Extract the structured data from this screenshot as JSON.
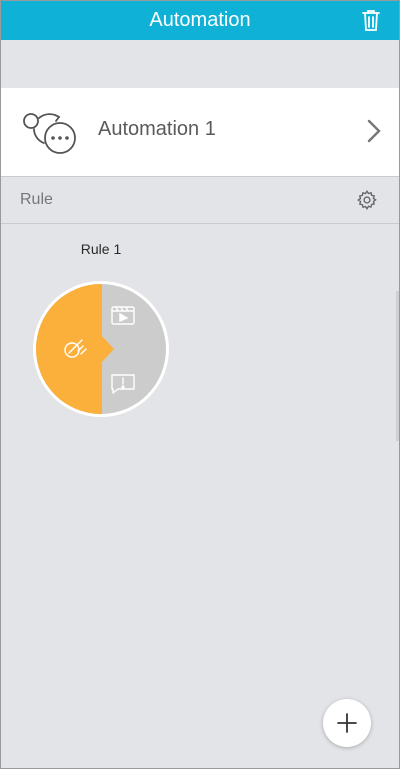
{
  "header": {
    "title": "Automation",
    "delete_icon": "trash-icon"
  },
  "automation": {
    "name": "Automation 1",
    "icon": "cycle-chat-icon",
    "chevron_icon": "chevron-right-icon"
  },
  "rule_section": {
    "label": "Rule",
    "settings_icon": "gear-icon"
  },
  "rules": [
    {
      "name": "Rule 1",
      "condition_icon": "sensor-icon",
      "action_icons": [
        "video-clip-icon",
        "alert-message-icon"
      ],
      "colors": {
        "condition": "#fbb03b",
        "actions": "#cccccc",
        "ring": "#ffffff"
      }
    }
  ],
  "fab": {
    "icon": "plus-icon"
  },
  "colors": {
    "header": "#0fb2d6",
    "background": "#e3e4e8",
    "card": "#ffffff"
  }
}
